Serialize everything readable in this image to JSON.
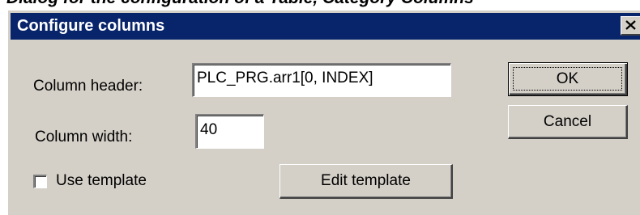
{
  "caption": "Dialog for the configuration of a Table, Category Columns",
  "dialog": {
    "title": "Configure columns",
    "close_icon": "close-x-icon"
  },
  "form": {
    "column_header_label": "Column header:",
    "column_header_value": "PLC_PRG.arr1[0, INDEX]",
    "column_width_label": "Column width:",
    "column_width_value": "40",
    "use_template_label": "Use template",
    "use_template_checked": false
  },
  "buttons": {
    "ok": "OK",
    "cancel": "Cancel",
    "edit_template": "Edit template"
  },
  "colors": {
    "titlebar": "#08246b",
    "dialog_face": "#d4d0c8"
  }
}
